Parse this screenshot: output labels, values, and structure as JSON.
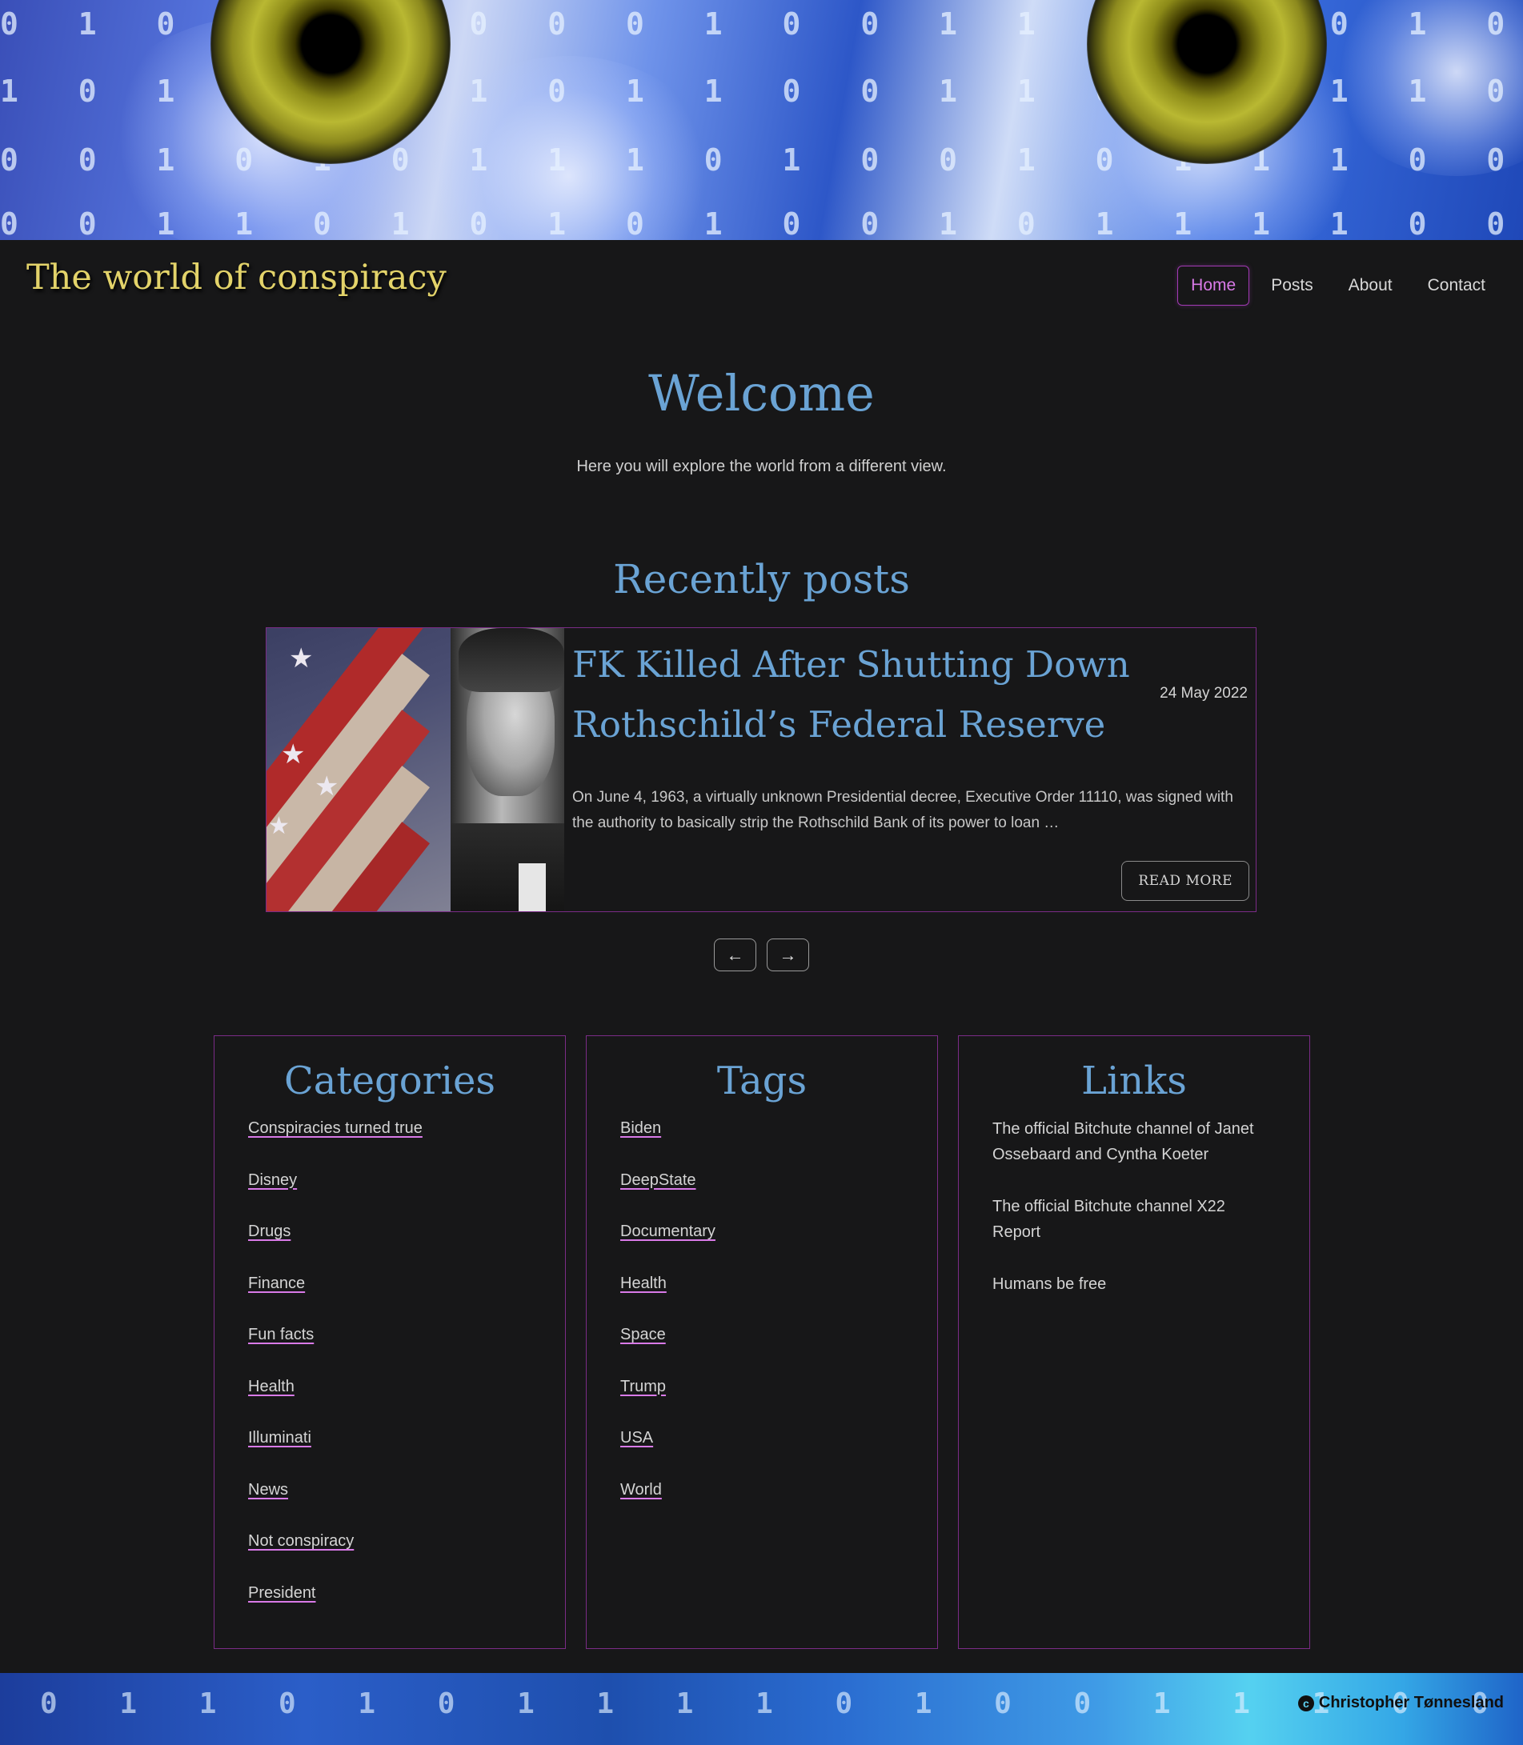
{
  "header": {
    "site_title": "The world of conspiracy",
    "nav": [
      {
        "label": "Home",
        "active": true
      },
      {
        "label": "Posts",
        "active": false
      },
      {
        "label": "About",
        "active": false
      },
      {
        "label": "Contact",
        "active": false
      }
    ]
  },
  "welcome": {
    "title": "Welcome",
    "subtitle": "Here you will explore the world from a different view."
  },
  "recent": {
    "title": "Recently posts",
    "post": {
      "title": "FK Killed After Shutting Down Rothschild’s Federal Reserve",
      "date": "24 May 2022",
      "excerpt": "On June 4, 1963, a virtually unknown Presidential decree, Executive Order 11110, was signed with the authority to basically strip the Rothschild Bank of its power to loan …",
      "read_more": "READ MORE"
    },
    "prev_icon": "arrow-left-icon",
    "next_icon": "arrow-right-icon"
  },
  "categories": {
    "title": "Categories",
    "items": [
      "Conspiracies turned true",
      "Disney",
      "Drugs",
      "Finance",
      "Fun facts",
      "Health",
      "Illuminati",
      "News",
      "Not conspiracy",
      "President"
    ]
  },
  "tags": {
    "title": "Tags",
    "items": [
      "Biden",
      "DeepState",
      "Documentary",
      "Health",
      "Space",
      "Trump",
      "USA",
      "World"
    ]
  },
  "links": {
    "title": "Links",
    "items": [
      "The official Bitchute channel of Janet Ossebaard and Cyntha Koeter",
      "The official Bitchute channel X22 Report",
      "Humans be free"
    ]
  },
  "footer": {
    "copyright": "Christopher Tønnesland"
  },
  "colors": {
    "accent": "#6aa3d4",
    "title": "#e3d36a",
    "border": "#7b2c87",
    "nav_active": "#d97ae8",
    "background": "#171718"
  }
}
